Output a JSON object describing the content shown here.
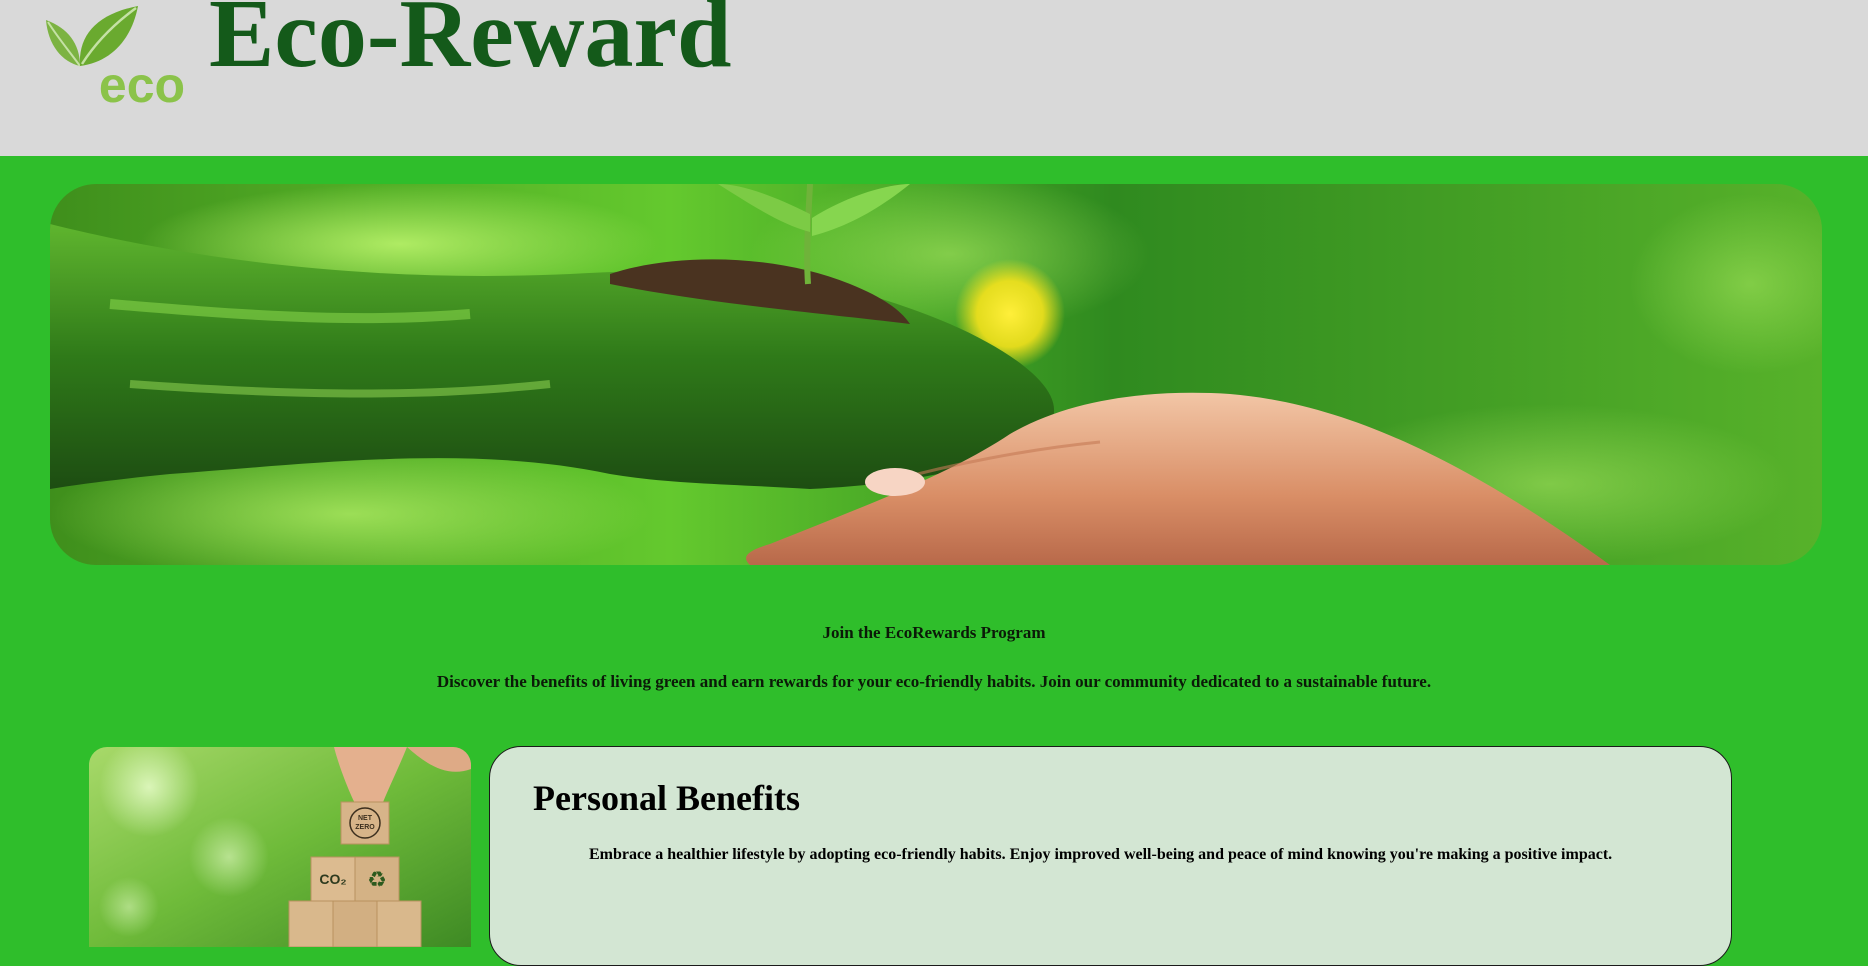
{
  "header": {
    "logo_text": "eco",
    "site_title": "Eco-Reward"
  },
  "hero": {
    "image": "hero-hands-sapling-image"
  },
  "intro": {
    "title": "Join the EcoRewards Program",
    "description": "Discover the benefits of living green and earn rewards for your eco-friendly habits. Join our community dedicated to a sustainable future."
  },
  "personal_benefits": {
    "image": "net-zero-blocks-image",
    "title": "Personal Benefits",
    "text": "Embrace a healthier lifestyle by adopting eco-friendly habits. Enjoy improved well-being and peace of mind knowing you're making a positive impact."
  },
  "colors": {
    "page_background": "#2fbe2b",
    "header_background": "#d9d9d9",
    "title_green": "#145a1a",
    "logo_green": "#8bc34a",
    "card_background": "#d3e6d3"
  }
}
